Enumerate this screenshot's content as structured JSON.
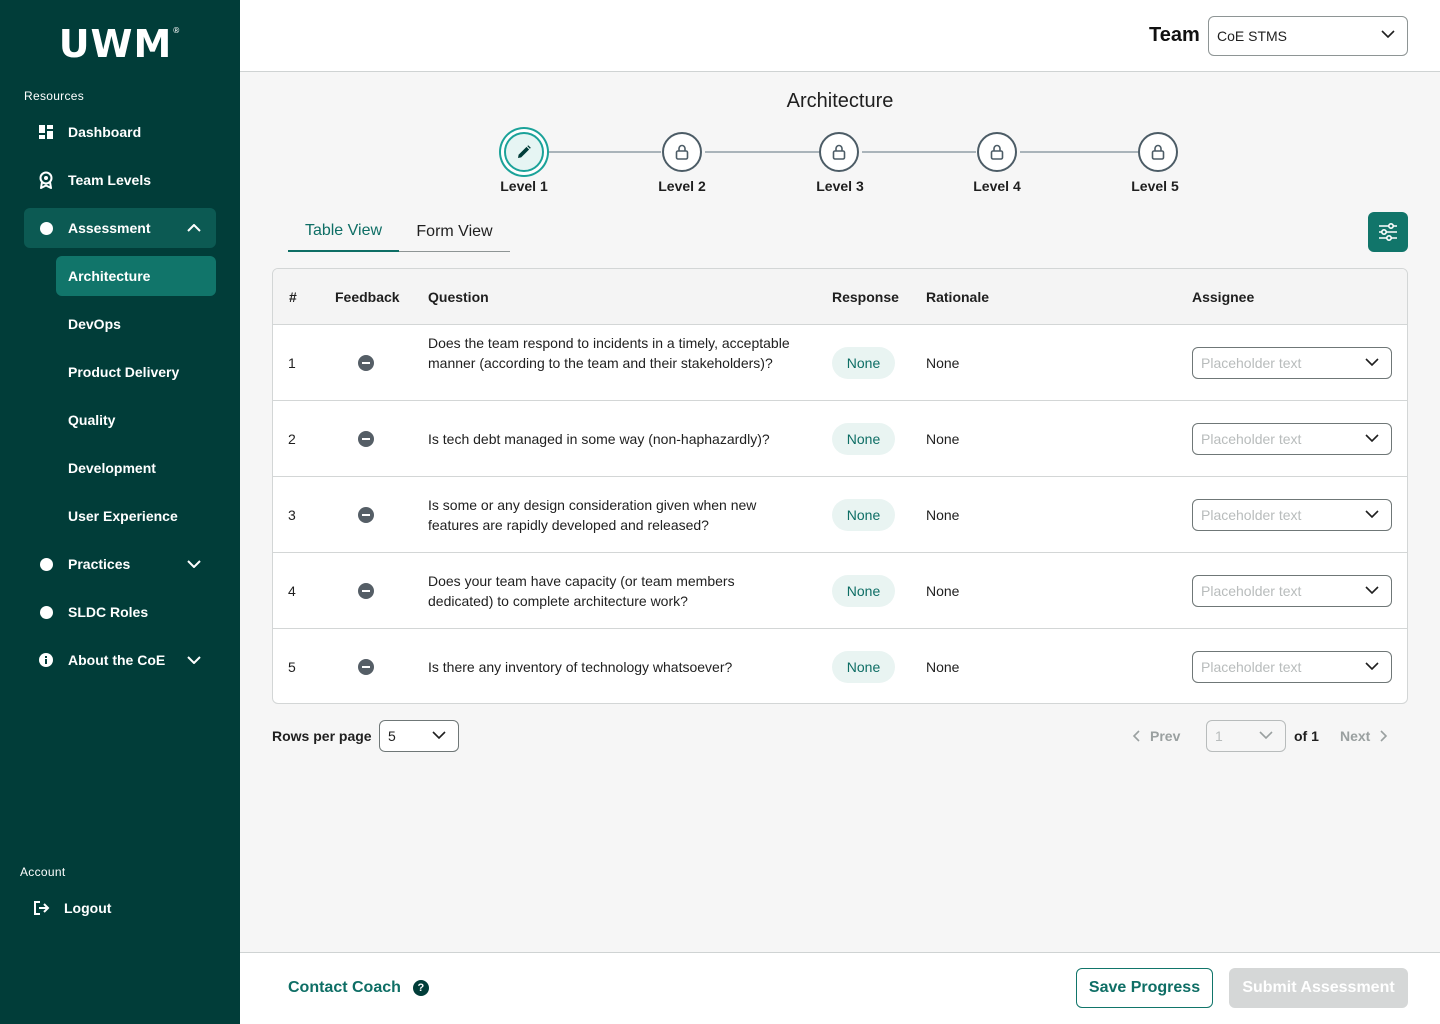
{
  "brand": {
    "logo": "UWM",
    "logo_mark": "®"
  },
  "sidebar": {
    "resources_label": "Resources",
    "items": [
      {
        "label": "Dashboard",
        "icon": "dashboard-icon"
      },
      {
        "label": "Team Levels",
        "icon": "award-icon"
      },
      {
        "label": "Assessment",
        "icon": "circle-icon"
      },
      {
        "label": "Practices",
        "icon": "circle-icon"
      },
      {
        "label": "SLDC Roles",
        "icon": "circle-icon"
      },
      {
        "label": "About the CoE",
        "icon": "info-icon"
      }
    ],
    "assessment_sub": [
      "Architecture",
      "DevOps",
      "Product Delivery",
      "Quality",
      "Development",
      "User Experience"
    ],
    "account_label": "Account",
    "logout_label": "Logout"
  },
  "header": {
    "team_label": "Team",
    "team_value": "CoE STMS"
  },
  "main": {
    "title": "Architecture",
    "levels": [
      "Level 1",
      "Level 2",
      "Level 3",
      "Level 4",
      "Level 5"
    ],
    "tabs": [
      "Table View",
      "Form View"
    ],
    "columns": [
      "#",
      "Feedback",
      "Question",
      "Response",
      "Rationale",
      "Assignee"
    ],
    "rows": [
      {
        "num": "1",
        "question": "Does the team respond to incidents in a timely, acceptable manner (according to the team and their stakeholders)?",
        "response": "None",
        "rationale": "None",
        "assignee_placeholder": "Placeholder text"
      },
      {
        "num": "2",
        "question": "Is tech debt managed in some way (non-haphazardly)?",
        "response": "None",
        "rationale": "None",
        "assignee_placeholder": "Placeholder text"
      },
      {
        "num": "3",
        "question": "Is some or any design consideration given when new features are rapidly developed and released?",
        "response": "None",
        "rationale": "None",
        "assignee_placeholder": "Placeholder text"
      },
      {
        "num": "4",
        "question": "Does your team have capacity (or team members dedicated) to complete architecture work?",
        "response": "None",
        "rationale": "None",
        "assignee_placeholder": "Placeholder text"
      },
      {
        "num": "5",
        "question": "Is there any inventory of technology whatsoever?",
        "response": "None",
        "rationale": "None",
        "assignee_placeholder": "Placeholder text"
      }
    ]
  },
  "pagination": {
    "rows_per_page_label": "Rows per page",
    "rows_per_page": "5",
    "prev": "Prev",
    "page": "1",
    "of": "of 1",
    "next": "Next"
  },
  "footer": {
    "contact": "Contact Coach",
    "help": "?",
    "save": "Save Progress",
    "submit": "Submit Assessment"
  }
}
